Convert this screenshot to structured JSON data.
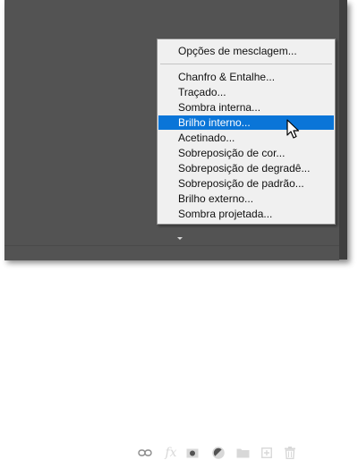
{
  "context_menu": {
    "items": [
      {
        "label": "Opções de mesclagem..."
      },
      {
        "label": "Chanfro & Entalhe..."
      },
      {
        "label": "Traçado..."
      },
      {
        "label": "Sombra interna..."
      },
      {
        "label": "Brilho interno...",
        "highlighted": true
      },
      {
        "label": "Acetinado..."
      },
      {
        "label": "Sobreposição de cor..."
      },
      {
        "label": "Sobreposição de degradê..."
      },
      {
        "label": "Sobreposição de padrão..."
      },
      {
        "label": "Brilho externo..."
      },
      {
        "label": "Sombra projetada..."
      }
    ],
    "highlight_color": "#0a75d8"
  },
  "toolbar": {
    "fx_label": "fx",
    "icons": [
      "link-icon",
      "fx-icon",
      "add-mask-icon",
      "adjustment-layer-icon",
      "folder-icon",
      "new-layer-icon",
      "trash-icon"
    ]
  },
  "colors": {
    "panel_bg": "#535353",
    "menu_bg": "#f0f0f0",
    "icon": "#d8d8d8"
  }
}
